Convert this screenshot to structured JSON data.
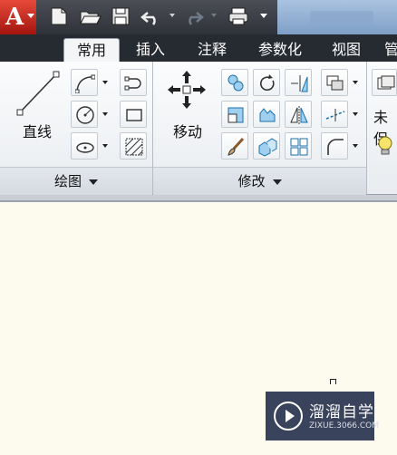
{
  "tabs": [
    "常用",
    "插入",
    "注释",
    "参数化",
    "视图",
    "管"
  ],
  "active_tab": "常用",
  "draw_panel": {
    "title": "绘图",
    "line_label": "直线"
  },
  "modify_panel": {
    "title": "修改",
    "move_label": "移动"
  },
  "layers_panel": {
    "truncated_text": "未保"
  },
  "watermark": {
    "title": "溜溜自学",
    "url": "ZIXUE.3066.COM"
  },
  "icons": {
    "app": "autocad-logo-icon",
    "qat": [
      "new-file-icon",
      "open-folder-icon",
      "save-icon",
      "undo-icon",
      "redo-icon",
      "plot-icon"
    ]
  },
  "colors": {
    "app_button": "#c8281c",
    "tab_bar": "#262a31",
    "canvas": "#fdfaee"
  }
}
